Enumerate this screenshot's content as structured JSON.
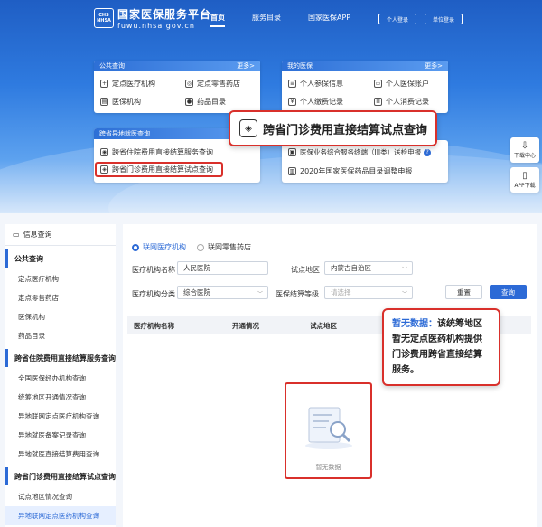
{
  "header": {
    "logo_abbr_top": "CHS",
    "logo_abbr_bottom": "NHSA",
    "logo_title": "国家医保服务平台",
    "logo_url": "fuwu.nhsa.gov.cn",
    "nav": [
      "首页",
      "服务目录",
      "国家医保APP"
    ],
    "personal_login": "个人登录",
    "org_login": "单位登录"
  },
  "public_card": {
    "title": "公共查询",
    "more": "更多>",
    "items": [
      "定点医疗机构",
      "定点零售药店",
      "医保机构",
      "药品目录"
    ]
  },
  "my_card": {
    "title": "我的医保",
    "more": "更多>",
    "items": [
      "个人参保信息",
      "个人医保账户",
      "个人缴费记录",
      "个人消费记录"
    ]
  },
  "cross_card": {
    "title": "跨省异地就医查询",
    "items": [
      "跨省住院费用直接结算服务查询",
      "跨省门诊费用直接结算试点查询"
    ]
  },
  "other_card": {
    "items": [
      "医保业务综合服务终端（III类）送检申报",
      "2020年国家医保药品目录调整申报"
    ]
  },
  "callout_text": "跨省门诊费用直接结算试点查询",
  "side_float": {
    "download": "下载中心",
    "app": "APP下载"
  },
  "left_menu": {
    "title": "信息查询",
    "sections": [
      {
        "name": "公共查询",
        "items": [
          "定点医疗机构",
          "定点零售药店",
          "医保机构",
          "药品目录"
        ]
      },
      {
        "name": "跨省住院费用直接结算服务查询",
        "items": [
          "全国医保经办机构查询",
          "统筹地区开通情况查询",
          "异地联网定点医疗机构查询",
          "异地就医备案记录查询",
          "异地就医直接结算费用查询"
        ]
      },
      {
        "name": "跨省门诊费用直接结算试点查询",
        "items": [
          "试点地区情况查询",
          "异地联网定点医药机构查询"
        ]
      }
    ]
  },
  "query": {
    "radio_medical": "联网医疗机构",
    "radio_pharmacy": "联网零售药店",
    "name_label": "医疗机构名称",
    "name_value": "人民医院",
    "region_label": "试点地区",
    "region_value": "内蒙古自治区",
    "type_label": "医疗机构分类",
    "type_value": "综合医院",
    "level_label": "医保结算等级",
    "level_placeholder": "请选择",
    "reset": "重置",
    "search": "查询"
  },
  "table": {
    "headers": [
      "医疗机构名称",
      "开通情况",
      "试点地区"
    ],
    "empty": "暂无数据"
  },
  "note": {
    "title": "暂无数据：",
    "body": "该统筹地区暂无定点医药机构提供门诊费用跨省直接结算服务。"
  },
  "colors": {
    "primary": "#2c6ad6",
    "highlight": "#d9302b"
  }
}
